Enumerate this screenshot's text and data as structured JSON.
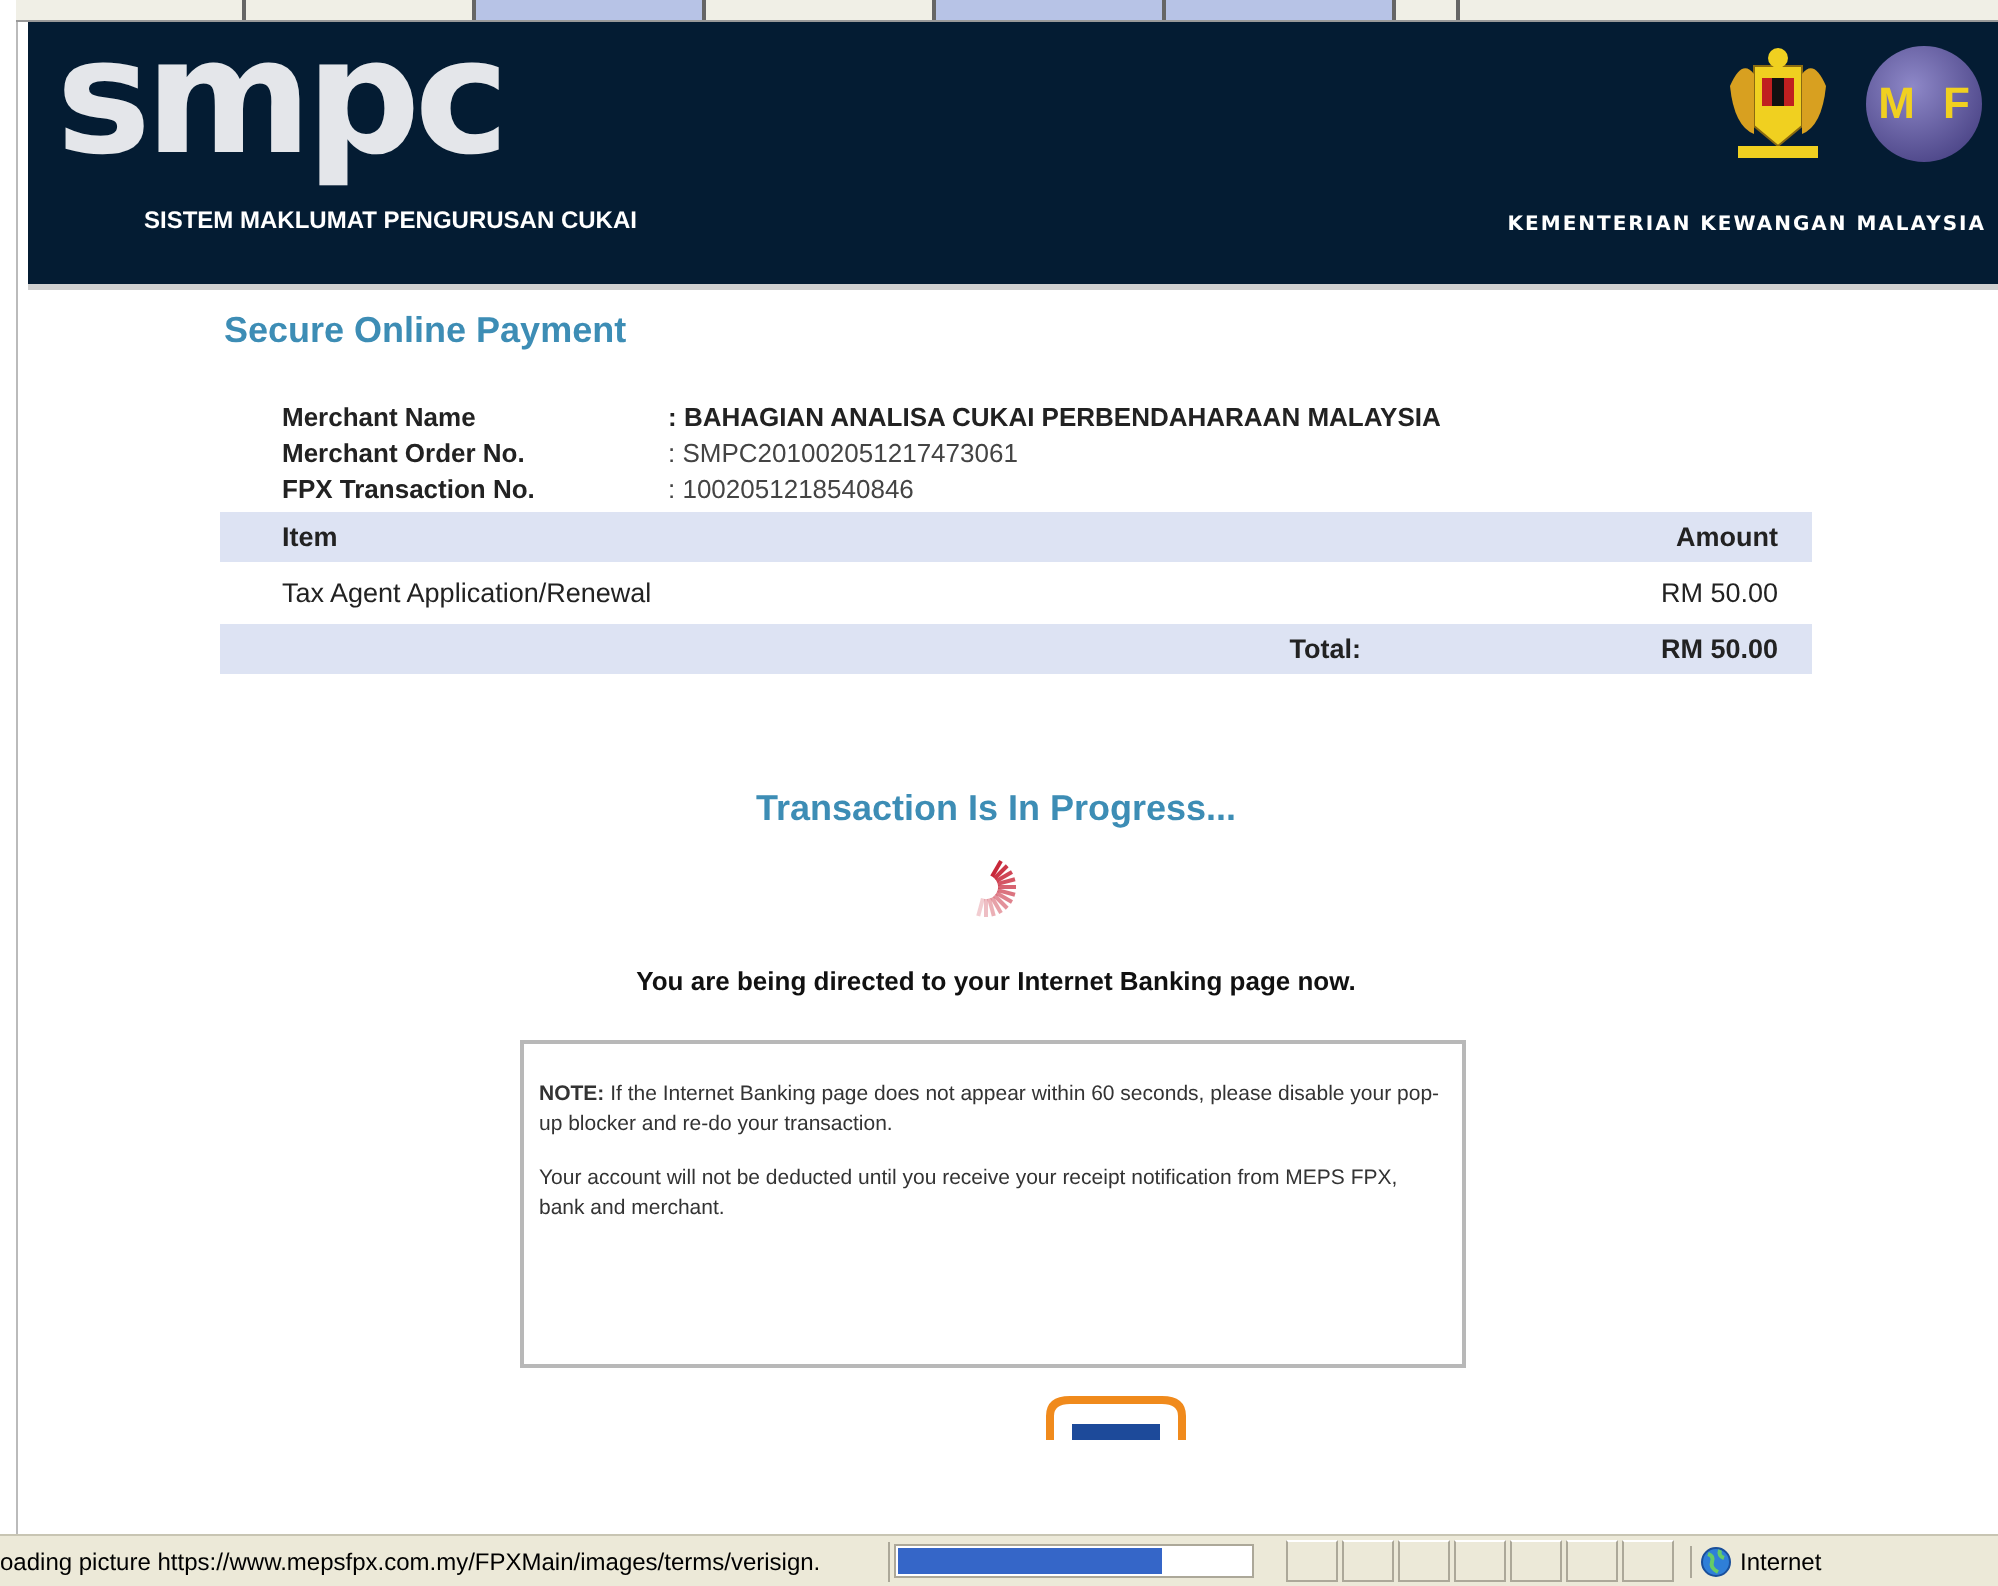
{
  "header": {
    "logo": "smpc",
    "subtitle": "SISTEM MAKLUMAT PENGURUSAN CUKAI",
    "ministry_logo_letters": [
      "M",
      "F"
    ],
    "ministry": "KEMENTERIAN KEWANGAN MALAYSIA"
  },
  "title": "Secure Online Payment",
  "details": [
    {
      "label": "Merchant Name",
      "value": ": BAHAGIAN ANALISA CUKAI PERBENDAHARAAN MALAYSIA",
      "bold": true
    },
    {
      "label": "Merchant Order No.",
      "value": ": SMPC201002051217473061",
      "bold": false
    },
    {
      "label": "FPX Transaction No.",
      "value": ": 1002051218540846",
      "bold": false
    }
  ],
  "table": {
    "columns": [
      "Item",
      "Amount"
    ],
    "rows": [
      [
        "Tax Agent Application/Renewal",
        "RM 50.00"
      ]
    ],
    "total_label": "Total:",
    "total": "RM 50.00"
  },
  "progress_heading": "Transaction Is In Progress...",
  "redirect_message": "You are being directed to your Internet Banking page now.",
  "note": [
    "**NOTE:**  If the Internet Banking page does not appear within 60 seconds, please disable your pop-up blocker and re-do your transaction.",
    "Your account will not be deducted until you receive your receipt notification from MEPS FPX, bank and merchant."
  ],
  "status_bar": {
    "text": "oading picture https://www.mepsfpx.com.my/FPXMain/images/terms/verisign.",
    "progress": {
      "level": 0.75
    },
    "zone": "Internet"
  }
}
